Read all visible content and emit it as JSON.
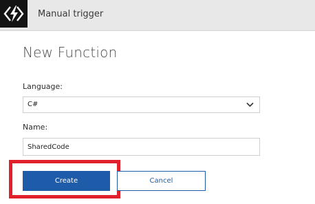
{
  "header": {
    "title": "Manual trigger",
    "logo_icon": "azure-functions-bolt-icon"
  },
  "page_title": "New Function",
  "language": {
    "label": "Language:",
    "selected": "C#"
  },
  "name": {
    "label": "Name:",
    "value": "SharedCode"
  },
  "buttons": {
    "create": "Create",
    "cancel": "Cancel"
  },
  "colors": {
    "accent": "#1e5ba8",
    "highlight": "#e0202b",
    "header_bg": "#e8e8e8"
  }
}
